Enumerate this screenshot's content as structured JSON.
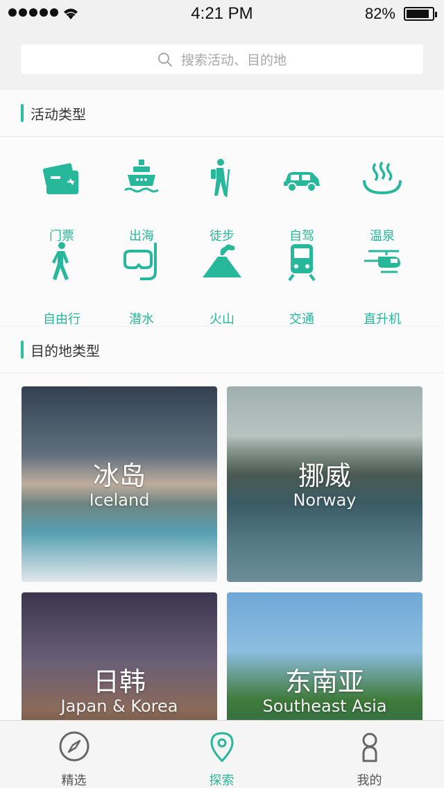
{
  "status_bar": {
    "time": "4:21 PM",
    "battery": "82%",
    "battery_level": 0.82
  },
  "search": {
    "placeholder": "搜索活动、目的地"
  },
  "activity_section": {
    "title": "活动类型",
    "items": [
      {
        "label": "门票",
        "icon": "ticket-icon"
      },
      {
        "label": "出海",
        "icon": "ship-icon"
      },
      {
        "label": "徒步",
        "icon": "hiker-icon"
      },
      {
        "label": "自驾",
        "icon": "car-icon"
      },
      {
        "label": "温泉",
        "icon": "hot-spring-icon"
      },
      {
        "label": "自由行",
        "icon": "walker-icon"
      },
      {
        "label": "潜水",
        "icon": "diving-mask-icon"
      },
      {
        "label": "火山",
        "icon": "volcano-icon"
      },
      {
        "label": "交通",
        "icon": "train-icon"
      },
      {
        "label": "直升机",
        "icon": "helicopter-icon"
      }
    ]
  },
  "destination_section": {
    "title": "目的地类型",
    "cards": [
      {
        "cn": "冰岛",
        "en": "Iceland"
      },
      {
        "cn": "挪威",
        "en": "Norway"
      },
      {
        "cn": "日韩",
        "en": "Japan & Korea"
      },
      {
        "cn": "东南亚",
        "en": "Southeast Asia"
      }
    ]
  },
  "tab_bar": {
    "tabs": [
      {
        "label": "精选",
        "icon": "compass-icon",
        "active": false
      },
      {
        "label": "探索",
        "icon": "location-pin-icon",
        "active": true
      },
      {
        "label": "我的",
        "icon": "person-icon",
        "active": false
      }
    ]
  },
  "colors": {
    "accent": "#27b79a"
  }
}
